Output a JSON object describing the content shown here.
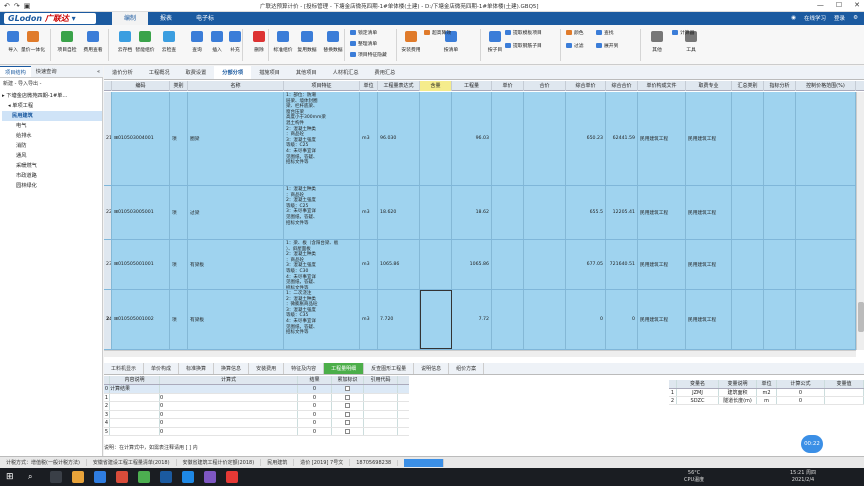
{
  "window": {
    "title": "广联达预算计价 - [投标管理 - 下塘金店微苑四期-1#单体楼(土建) - D:/下塘金店微苑四期-1#单体楼(土建).GBQ5]"
  },
  "brand": {
    "logo_text": "GLodon",
    "logo_cn": "广联达"
  },
  "menu": [
    "编制",
    "报表",
    "电子标"
  ],
  "menu_right": {
    "learn": "在线学习",
    "login": "登录"
  },
  "toolbar": {
    "buttons": [
      {
        "label": "导入",
        "color": "#3b7dd8"
      },
      {
        "label": "量价一体化",
        "color": "#e07b2b"
      },
      {
        "label": "项目自检",
        "color": "#3aa34a"
      },
      {
        "label": "费用查看",
        "color": "#3b7dd8"
      },
      {
        "label": "云存档",
        "color": "#3b9ee0"
      },
      {
        "label": "智能组价",
        "color": "#3aa34a"
      },
      {
        "label": "云检查",
        "color": "#3b9ee0"
      },
      {
        "label": "查询",
        "color": "#3b7dd8"
      },
      {
        "label": "插入",
        "color": "#3b7dd8"
      },
      {
        "label": "补充",
        "color": "#3b7dd8"
      },
      {
        "label": "删除",
        "color": "#d33"
      },
      {
        "label": "标准组价",
        "color": "#3b7dd8"
      },
      {
        "label": "复用数据",
        "color": "#3b7dd8"
      },
      {
        "label": "替换数据",
        "color": "#3b7dd8"
      },
      {
        "label": "安装费用",
        "color": "#e07b2b"
      },
      {
        "label": "按清单",
        "color": "#3b7dd8"
      },
      {
        "label": "按子目",
        "color": "#3b7dd8"
      },
      {
        "label": "其他",
        "color": "#777"
      },
      {
        "label": "工具",
        "color": "#777"
      }
    ],
    "small": [
      "锁定清单",
      "整理清单",
      "项目特征隐藏",
      "超高降效",
      "提取模板项目",
      "提取钢筋子目",
      "颜色",
      "过滤",
      "查找",
      "展开到",
      "计算器"
    ]
  },
  "leftpanel": {
    "tabs": [
      "项目结构",
      "快速查询"
    ],
    "tools": "新建 - 导入导出 -",
    "tree": [
      "下塘金店微苑四期-1#单...",
      "单项工程",
      "民用建筑",
      "电气",
      "给排水",
      "消防",
      "通风",
      "采暖燃气",
      "市政道路",
      "园林绿化"
    ]
  },
  "main_tabs": [
    "造价分析",
    "工程概况",
    "取费设置",
    "分部分项",
    "措施项目",
    "其他项目",
    "人材机汇总",
    "费用汇总"
  ],
  "grid": {
    "columns": [
      "编码",
      "类别",
      "名称",
      "项目特征",
      "单位",
      "工程量表达式",
      "含量",
      "工程量",
      "单价",
      "合价",
      "综合单价",
      "综合合价",
      "单价构成文件",
      "取费专业",
      "汇总类别",
      "指标分析",
      "控制价格范围(%)"
    ],
    "rows": [
      {
        "no": "21",
        "code": "010503004001",
        "type": "项",
        "name": "圈梁",
        "feature": "1：部位：防潮\n层梁、墙体封圈\n梁、栏杆底梁、\n窗台压梁\n高度小于300mm梁\n混土构件\n2：混凝土种类\n：商品砼\n3：混凝土强度\n等级：C25\n4：未尽事宜详\n见图纸，答疑、\n招标文件等",
        "unit": "m3",
        "expr": "96.030",
        "qty": "96.03",
        "price": "650.23",
        "total": "62441.59",
        "file": "民用建筑工程",
        "prof": "民用建筑工程"
      },
      {
        "no": "22",
        "code": "010503005001",
        "type": "项",
        "name": "过梁",
        "feature": "1：混凝土种类\n：商品砼\n2：混凝土强度\n等级：C25\n3：未尽事宜详\n见图纸，答疑、\n招标文件等",
        "unit": "m3",
        "expr": "18.620",
        "qty": "18.62",
        "price": "655.5",
        "total": "12205.41",
        "file": "民用建筑工程",
        "prof": "民用建筑工程"
      },
      {
        "no": "23",
        "code": "010505001001",
        "type": "项",
        "name": "有梁板",
        "feature": "1：梁、板（含阳台梁、板\n）、斜屋面板\n2：混凝土种类\n：商品砼\n3：混凝土强度\n等级：C30\n4：未尽事宜详\n见图纸，答疑、\n招标文件等",
        "unit": "m3",
        "expr": "1065.86",
        "qty": "1065.86",
        "price": "677.05",
        "total": "721640.51",
        "file": "民用建筑工程",
        "prof": "民用建筑工程"
      },
      {
        "no": "24",
        "code": "010505001002",
        "type": "项",
        "name": "有梁板",
        "feature": "1：二次浇注\n2：混凝土种类\n：微膨胀商品砼\n3：混凝土强度\n等级：C35\n4：未尽事宜详\n见图纸，答疑、\n招标文件等",
        "unit": "m3",
        "expr": "7.720",
        "qty": "7.72",
        "price": "0",
        "total": "0",
        "file": "民用建筑工程",
        "prof": "民用建筑工程"
      }
    ]
  },
  "bottom_tabs": [
    "工料机显示",
    "单价构成",
    "标准换算",
    "换算信息",
    "安装费用",
    "特征及内容",
    "工程量明细",
    "反查图形工程量",
    "说明信息",
    "组价方案"
  ],
  "calc": {
    "headers": [
      "",
      "内容说明",
      "计算式",
      "结果",
      "累加标识",
      "引用代码"
    ],
    "rows": [
      {
        "n": "0",
        "desc": "计算结果",
        "formula": "",
        "result": "0"
      },
      {
        "n": "1",
        "desc": "",
        "formula": "0",
        "result": "0"
      },
      {
        "n": "2",
        "desc": "",
        "formula": "0",
        "result": "0"
      },
      {
        "n": "3",
        "desc": "",
        "formula": "0",
        "result": "0"
      },
      {
        "n": "4",
        "desc": "",
        "formula": "0",
        "result": "0"
      },
      {
        "n": "5",
        "desc": "",
        "formula": "0",
        "result": "0"
      }
    ]
  },
  "vars": {
    "headers": [
      "",
      "变量名",
      "变量说明",
      "单位",
      "计算公式",
      "变量值"
    ],
    "rows": [
      {
        "n": "1",
        "name": "JZMJ",
        "desc": "建筑面积",
        "unit": "m2",
        "formula": "0",
        "val": ""
      },
      {
        "n": "2",
        "name": "SDZC",
        "desc": "隧道长度(m)",
        "unit": "m",
        "formula": "0",
        "val": ""
      }
    ]
  },
  "hint": "说明：在计算式中，如需表注释请用 [ ] 内",
  "statusbar": [
    "计税方式：增值税(一般计税方法)",
    "安徽省建设工程工程量清单(2018)",
    "安徽省建筑工程计价定额(2018)",
    "民用建筑",
    "造价 [2019] 7号文",
    "18705698238"
  ],
  "timer": "00:22",
  "tray": {
    "temp": "56°C",
    "cpu": "CPU温度",
    "time": "15:21 周四",
    "date": "2021/2/4"
  }
}
